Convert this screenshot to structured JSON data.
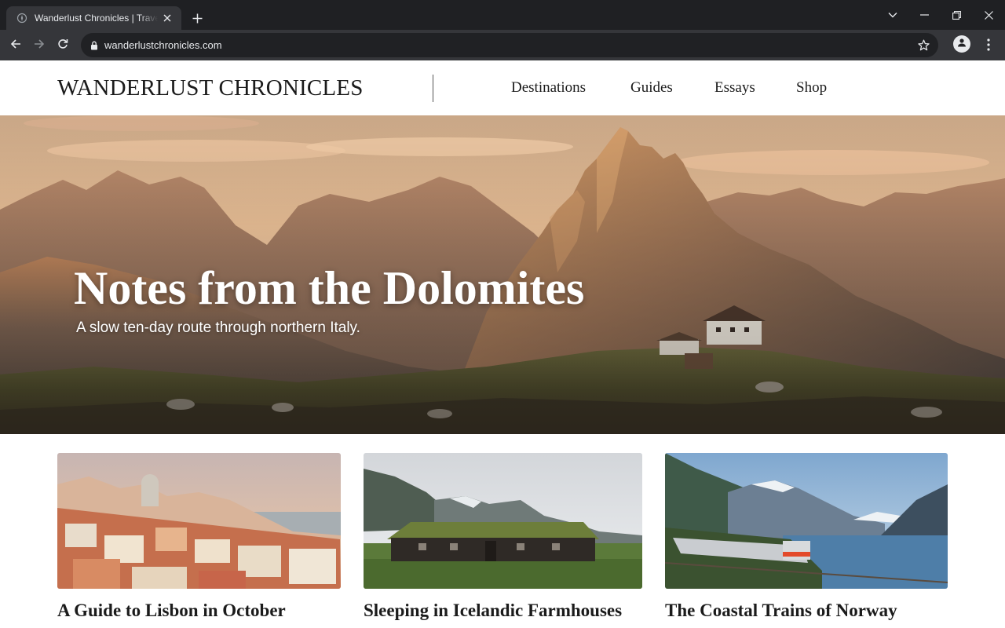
{
  "browser": {
    "tab_title": "Wanderlust Chronicles | Travel Magazine",
    "url": "wanderlustchronicles.com"
  },
  "icons": {
    "favicon": "compass-icon",
    "tab_close": "close-icon",
    "new_tab": "plus-icon",
    "tab_search": "chevron-down-icon",
    "minimize": "minimize-icon",
    "maximize": "restore-icon",
    "close_window": "close-icon",
    "back": "arrow-left-icon",
    "forward": "arrow-right-icon",
    "reload": "reload-icon",
    "lock": "lock-icon",
    "bookmark": "star-icon",
    "profile": "person-icon",
    "menu": "kebab-menu-icon"
  },
  "site": {
    "logo": "WANDERLUST CHRONICLES",
    "nav": [
      "Destinations",
      "Guides",
      "Essays",
      "Shop"
    ]
  },
  "hero": {
    "title": "Notes from the Dolomites",
    "subtitle": "A slow ten-day route through northern Italy."
  },
  "articles": [
    {
      "title": "A Guide to Lisbon in October"
    },
    {
      "title": "Sleeping in Icelandic Farmhouses"
    },
    {
      "title": "The Coastal Trains of Norway"
    }
  ],
  "colors": {
    "chrome_dark": "#1f2023",
    "chrome_toolbar": "#35363a",
    "omnibox": "#202124",
    "text_dark": "#1b1b1b"
  }
}
